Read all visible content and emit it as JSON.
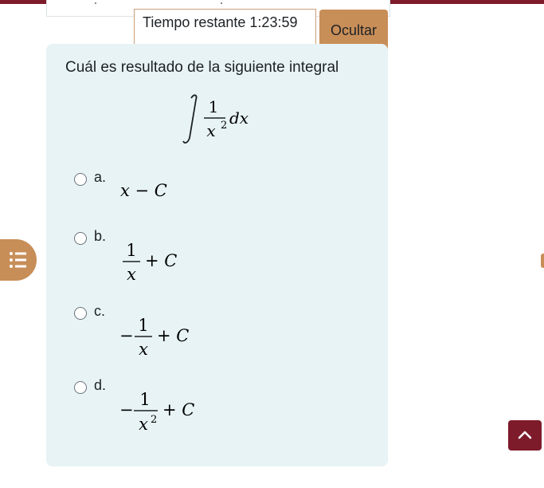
{
  "timer": {
    "label": "Tiempo restante",
    "value": "1:23:59",
    "hide_button": "Ocultar"
  },
  "question": {
    "text": "Cuál es resultado de la siguiente integral",
    "integral": {
      "numerator": "1",
      "denominator": "x",
      "exponent": "2",
      "differential": "dx"
    },
    "options": [
      {
        "letter": "a.",
        "expr": "x − C"
      },
      {
        "letter": "b.",
        "numerator": "1",
        "denominator": "x",
        "tail": "+ C"
      },
      {
        "letter": "c.",
        "sign": "−",
        "numerator": "1",
        "denominator": "x",
        "tail": "+ C"
      },
      {
        "letter": "d.",
        "sign": "−",
        "numerator": "1",
        "denominator": "x",
        "exponent": "2",
        "tail": "+ C"
      }
    ]
  },
  "icons": {
    "nav": "list-icon",
    "scroll_top": "chevron-up-icon"
  },
  "colors": {
    "brand": "#7d1b2b",
    "accent": "#c88e58",
    "question_bg": "#e7f3f5"
  }
}
